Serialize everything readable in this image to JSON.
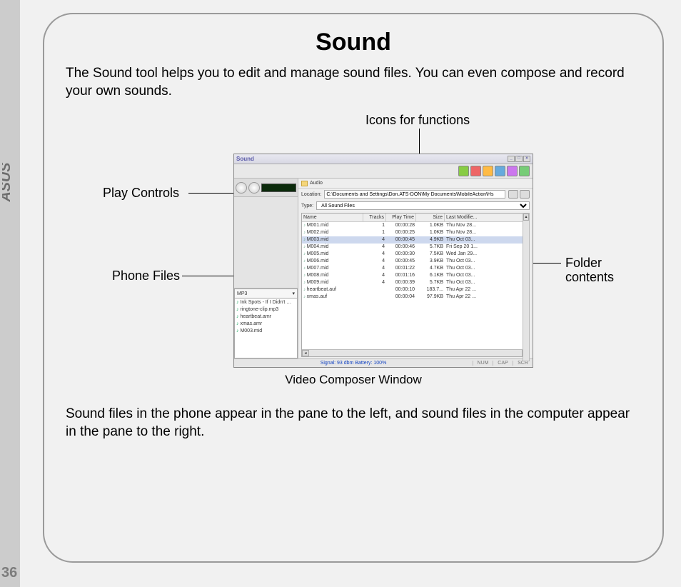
{
  "page": {
    "brand": "ASUS",
    "number": "36",
    "title": "Sound",
    "intro": "The Sound tool helps you to edit and manage sound files. You can even compose and record your own sounds.",
    "outro": "Sound files in the phone appear in the pane to the left, and sound files in the computer appear in the pane to the right.",
    "caption": "Video Composer Window"
  },
  "callouts": {
    "icons": "Icons for functions",
    "play": "Play Controls",
    "phone": "Phone Files",
    "folder1": "Folder",
    "folder2": "contents"
  },
  "app": {
    "title": "Sound",
    "folder_tab": "Audio",
    "location_label": "Location:",
    "location_value": "C:\\Documents and Settings\\Don.ATS-DON\\My Documents\\MobileAction\\Hs",
    "type_label": "Type:",
    "type_value": "All Sound Files",
    "phone_tab": "MP3",
    "columns": {
      "name": "Name",
      "tracks": "Tracks",
      "time": "Play Time",
      "size": "Size",
      "date": "Last Modifie..."
    },
    "phone_files": [
      "Ink Spots - If I Didn't …",
      "ringtone-clip.mp3",
      "heartbeat.amr",
      "xmas.amr",
      "M003.mid"
    ],
    "rows": [
      {
        "name": "M001.mid",
        "tracks": "1",
        "time": "00:00:28",
        "size": "1.0KB",
        "date": "Thu Nov 28...",
        "sel": false
      },
      {
        "name": "M002.mid",
        "tracks": "1",
        "time": "00:00:25",
        "size": "1.0KB",
        "date": "Thu Nov 28...",
        "sel": false
      },
      {
        "name": "M003.mid",
        "tracks": "4",
        "time": "00:00:45",
        "size": "4.9KB",
        "date": "Thu Oct 03...",
        "sel": true
      },
      {
        "name": "M004.mid",
        "tracks": "4",
        "time": "00:00:46",
        "size": "5.7KB",
        "date": "Fri Sep 20 1...",
        "sel": false
      },
      {
        "name": "M005.mid",
        "tracks": "4",
        "time": "00:00:30",
        "size": "7.5KB",
        "date": "Wed Jan 29...",
        "sel": false
      },
      {
        "name": "M006.mid",
        "tracks": "4",
        "time": "00:00:45",
        "size": "3.9KB",
        "date": "Thu Oct 03...",
        "sel": false
      },
      {
        "name": "M007.mid",
        "tracks": "4",
        "time": "00:01:22",
        "size": "4.7KB",
        "date": "Thu Oct 03...",
        "sel": false
      },
      {
        "name": "M008.mid",
        "tracks": "4",
        "time": "00:01:16",
        "size": "6.1KB",
        "date": "Thu Oct 03...",
        "sel": false
      },
      {
        "name": "M009.mid",
        "tracks": "4",
        "time": "00:00:39",
        "size": "5.7KB",
        "date": "Thu Oct 03...",
        "sel": false
      },
      {
        "name": "heartbeat.auf",
        "tracks": "",
        "time": "00:00:10",
        "size": "183.7...",
        "date": "Thu Apr 22 ...",
        "sel": false
      },
      {
        "name": "xmas.auf",
        "tracks": "",
        "time": "00:00:04",
        "size": "97.9KB",
        "date": "Thu Apr 22 ...",
        "sel": false
      }
    ],
    "status_signal": "Signal: 93 dbm Battery: 100%",
    "status_num": "NUM",
    "status_cap": "CAP",
    "status_scr": "SCR"
  }
}
